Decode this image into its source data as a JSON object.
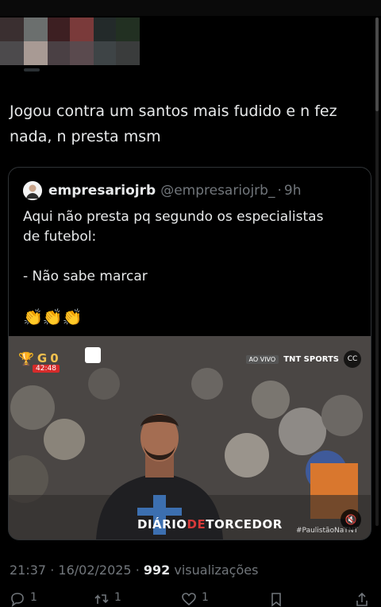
{
  "tweet": {
    "text_line1": "Jogou contra um santos mais fudido e n fez",
    "text_line2": "nada, n presta msm"
  },
  "quote": {
    "name": "empresariojrb",
    "handle": "@empresariojrb_",
    "separator": "·",
    "time": "9h",
    "lines": [
      "Aqui não presta pq segundo os especialistas",
      "de futebol:",
      "",
      "- Não sabe marcar"
    ],
    "emojis": "👏👏👏",
    "video": {
      "team_abbr": "G",
      "team_score": "0",
      "clock": "42:48",
      "live_tag": "AO VIVO",
      "broadcaster": "TNT SPORTS",
      "cc_label": "CC",
      "watermark_a": "DIÁRIO",
      "watermark_b": "DE",
      "watermark_c": "TORCEDOR",
      "hashtag": "#PaulistãoNaTNT",
      "mute_icon": "🔇"
    }
  },
  "meta": {
    "time": "21:37",
    "sep1": "·",
    "date": "16/02/2025",
    "sep2": "·",
    "views_count": "992",
    "views_label": "visualizações"
  },
  "actions": {
    "replies": "1",
    "retweets": "1",
    "likes": "1"
  },
  "colors": {
    "background": "#000000",
    "text": "#e7e9ea",
    "muted": "#71767b",
    "border": "#2f3336"
  }
}
